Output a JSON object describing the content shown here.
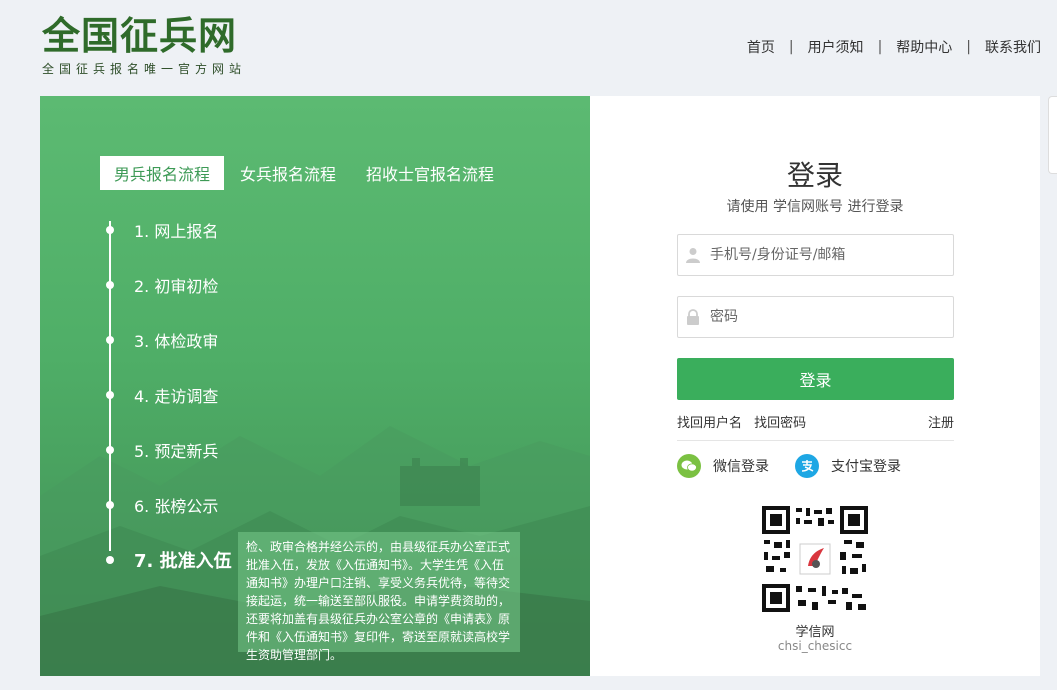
{
  "header": {
    "logo_title": "全国征兵网",
    "logo_subtitle": "全国征兵报名唯一官方网站",
    "nav": [
      "首页",
      "用户须知",
      "帮助中心",
      "联系我们"
    ],
    "nav_separator": "|"
  },
  "process": {
    "tabs": [
      "男兵报名流程",
      "女兵报名流程",
      "招收士官报名流程"
    ],
    "active_tab": 0,
    "steps": [
      "1. 网上报名",
      "2. 初审初检",
      "3. 体检政审",
      "4. 走访调查",
      "5. 预定新兵",
      "6. 张榜公示",
      "7. 批准入伍"
    ],
    "active_step": 6,
    "tooltip": "检、政审合格并经公示的，由县级征兵办公室正式批准入伍，发放《入伍通知书》。大学生凭《入伍通知书》办理户口注销、享受义务兵优待，等待交接起运，统一输送至部队服役。申请学费资助的，还要将加盖有县级征兵办公室公章的《申请表》原件和《入伍通知书》复印件，寄送至原就读高校学生资助管理部门。"
  },
  "login": {
    "title": "登录",
    "subtitle": "请使用  学信网账号  进行登录",
    "username_placeholder": "手机号/身份证号/邮箱",
    "password_placeholder": "密码",
    "submit": "登录",
    "find_username": "找回用户名",
    "find_password": "找回密码",
    "register": "注册",
    "wechat": "微信登录",
    "alipay": "支付宝登录",
    "qr_caption": "学信网",
    "qr_subcaption": "chsi_chesicc"
  },
  "colors": {
    "brand_green": "#3aae5c",
    "panel_green": "#53b06c",
    "logo_green": "#2f6b2a",
    "wechat": "#7bc142",
    "alipay": "#1ea7e4"
  },
  "icons": [
    "user-icon",
    "lock-icon",
    "wechat-icon",
    "alipay-icon",
    "qr-code-icon"
  ]
}
